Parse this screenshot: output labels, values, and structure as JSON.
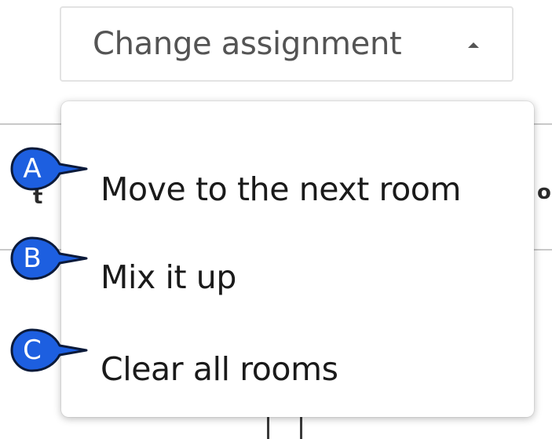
{
  "trigger": {
    "label": "Change assignment",
    "caret_icon": "caret-up-icon"
  },
  "menu": {
    "items": [
      {
        "label": "Move to the next room",
        "callout": "A"
      },
      {
        "label": "Mix it up",
        "callout": "B"
      },
      {
        "label": "Clear all rooms",
        "callout": "C"
      }
    ]
  },
  "colors": {
    "callout_fill": "#1d5fe0",
    "callout_stroke": "#0b1a3a",
    "menu_text": "#1a1a1a",
    "trigger_text": "#545454"
  }
}
